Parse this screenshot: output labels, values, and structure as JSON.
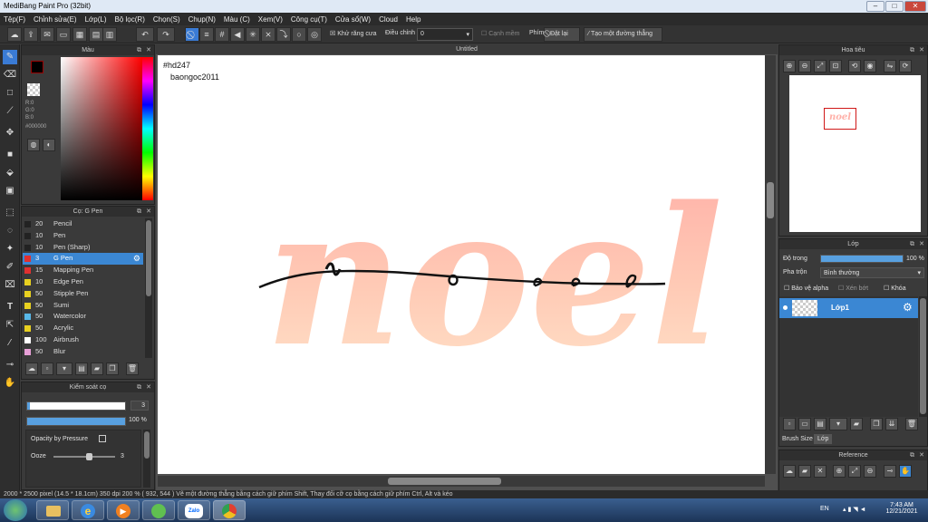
{
  "window": {
    "title": "MediBang Paint Pro (32bit)"
  },
  "menu": [
    "Tệp(F)",
    "Chỉnh sửa(E)",
    "Lớp(L)",
    "Bộ lọc(R)",
    "Chọn(S)",
    "Chụp(N)",
    "Màu (C)",
    "Xem(V)",
    "Công cụ(T)",
    "Cửa sổ(W)",
    "Cloud",
    "Help"
  ],
  "toolbar": {
    "antialias_label": "Khử răng cưa",
    "adjust_label": "Điều chỉnh",
    "adjust_value": "0",
    "sharp_label": "Cạnh mềm",
    "key_label": "Phím",
    "reset_label": "Đặt lại",
    "line_label": "Tạo một đường thẳng"
  },
  "color_panel": {
    "title": "Màu",
    "r": "R:0",
    "g": "G:0",
    "b": "B:0",
    "hex": "#000000",
    "fg": "#000000",
    "bg": "#ffffff"
  },
  "brush_panel": {
    "title": "Cọ: G Pen",
    "items": [
      {
        "size": "20",
        "name": "Pencil",
        "color": "#222222"
      },
      {
        "size": "10",
        "name": "Pen",
        "color": "#222222"
      },
      {
        "size": "10",
        "name": "Pen (Sharp)",
        "color": "#222222"
      },
      {
        "size": "3",
        "name": "G Pen",
        "color": "#e03030"
      },
      {
        "size": "15",
        "name": "Mapping Pen",
        "color": "#e03030"
      },
      {
        "size": "10",
        "name": "Edge Pen",
        "color": "#e8d020"
      },
      {
        "size": "50",
        "name": "Stipple Pen",
        "color": "#e8d020"
      },
      {
        "size": "50",
        "name": "Sumi",
        "color": "#e8d020"
      },
      {
        "size": "50",
        "name": "Watercolor",
        "color": "#58b8e8"
      },
      {
        "size": "50",
        "name": "Acrylic",
        "color": "#e8d020"
      },
      {
        "size": "100",
        "name": "Airbrush",
        "color": "#ffffff"
      },
      {
        "size": "50",
        "name": "Blur",
        "color": "#e8a0d8"
      }
    ],
    "selected_index": 3
  },
  "brush_control": {
    "title": "Kiểm soát cọ",
    "size_value": "3",
    "size_fraction": 0.03,
    "opacity_value": "100 %",
    "opacity_fraction": 1.0,
    "opacity_pressure_label": "Opacity by Pressure",
    "ooze_label": "Ooze",
    "ooze_value": "3"
  },
  "canvas": {
    "tab_title": "Untitled",
    "text_line1": "#hd247",
    "text_line2": "baongoc2011",
    "art_text": "noel"
  },
  "navigator": {
    "title": "Hoa tiêu"
  },
  "layer_panel": {
    "title": "Lớp",
    "opacity_label": "Độ trong",
    "opacity_value": "100 %",
    "opacity_fraction": 1.0,
    "blend_label": "Pha trộn",
    "blend_value": "Bình thường",
    "protect_alpha": "Bảo vệ alpha",
    "clipping": "Xén bớt",
    "lock": "Khóa",
    "layer_name": "Lớp1",
    "tab_brush_size": "Brush Size",
    "tab_layer": "Lớp"
  },
  "reference": {
    "title": "Reference"
  },
  "status": {
    "text": "2000 * 2500 pixel   (14.5 * 18.1cm)   350 dpi   200 %   ( 932, 544 )   Vẽ một đường thẳng bằng cách giữ phím Shift, Thay đổi cỡ cọ bằng cách giữ phím Ctrl, Alt và kéo"
  },
  "taskbar": {
    "lang": "EN",
    "time": "7:43 AM",
    "date": "12/21/2021",
    "zalo": "Zalo"
  }
}
